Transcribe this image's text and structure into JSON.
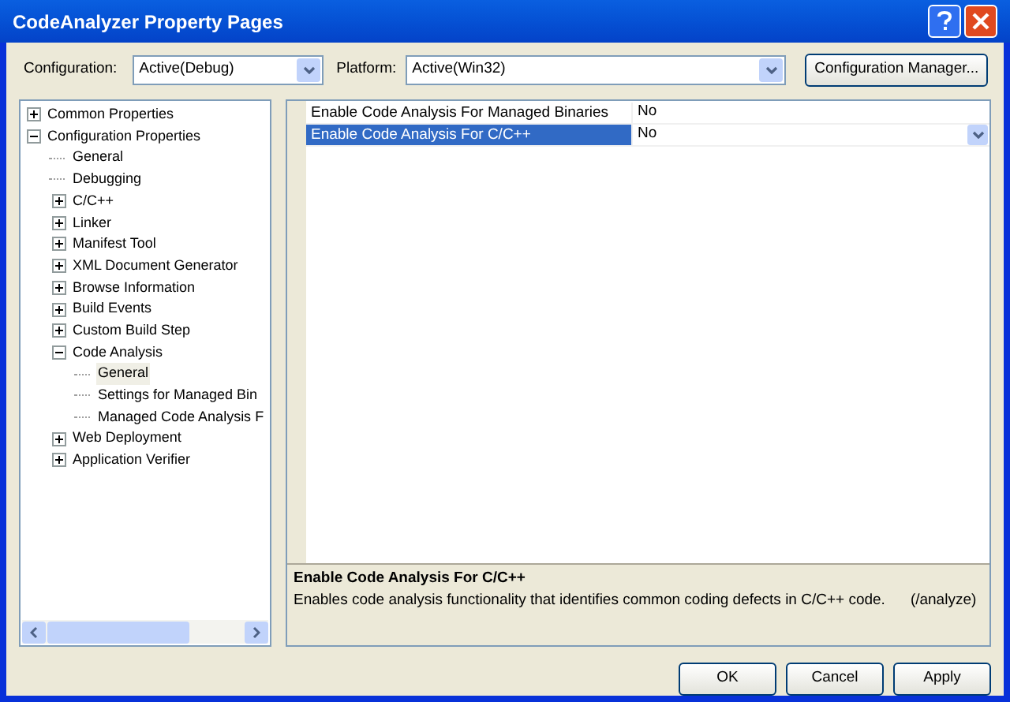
{
  "window": {
    "title": "CodeAnalyzer Property Pages"
  },
  "toolbar": {
    "configuration": {
      "label": "Configuration:",
      "value": "Active(Debug)"
    },
    "platform": {
      "label": "Platform:",
      "value": "Active(Win32)"
    },
    "manager_button": "Configuration Manager..."
  },
  "tree": [
    {
      "label": "Common Properties",
      "expanded": false,
      "selected": false
    },
    {
      "label": "Configuration Properties",
      "expanded": true,
      "selected": false,
      "children": [
        {
          "label": "General",
          "selected": false
        },
        {
          "label": "Debugging",
          "selected": false
        },
        {
          "label": "C/C++",
          "expanded": false,
          "selected": false
        },
        {
          "label": "Linker",
          "expanded": false,
          "selected": false
        },
        {
          "label": "Manifest Tool",
          "expanded": false,
          "selected": false
        },
        {
          "label": "XML Document Generator",
          "expanded": false,
          "selected": false
        },
        {
          "label": "Browse Information",
          "expanded": false,
          "selected": false
        },
        {
          "label": "Build Events",
          "expanded": false,
          "selected": false
        },
        {
          "label": "Custom Build Step",
          "expanded": false,
          "selected": false
        },
        {
          "label": "Code Analysis",
          "expanded": true,
          "selected": false,
          "children": [
            {
              "label": "General",
              "selected": true
            },
            {
              "label": "Settings for Managed Bin",
              "selected": false
            },
            {
              "label": "Managed Code Analysis F",
              "selected": false
            }
          ]
        },
        {
          "label": "Web Deployment",
          "expanded": false,
          "selected": false
        },
        {
          "label": "Application Verifier",
          "expanded": false,
          "selected": false
        }
      ]
    }
  ],
  "properties": [
    {
      "name": "Enable Code Analysis For Managed Binaries",
      "value": "No",
      "selected": false
    },
    {
      "name": "Enable Code Analysis For C/C++",
      "value": "No",
      "selected": true
    }
  ],
  "description": {
    "title": "Enable Code Analysis For C/C++",
    "text": "Enables code analysis functionality that identifies common coding defects in C/C++ code.",
    "option": "(/analyze)"
  },
  "buttons": [
    "OK",
    "Cancel",
    "Apply"
  ]
}
